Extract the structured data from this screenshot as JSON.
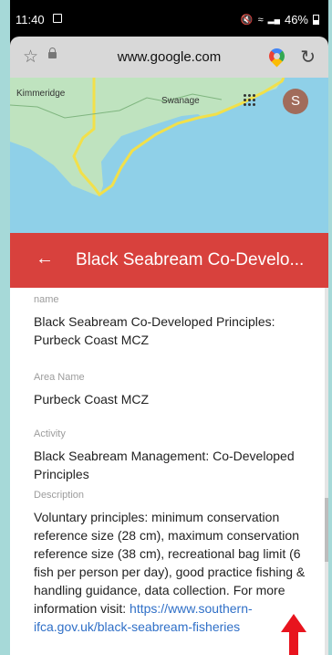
{
  "status_bar": {
    "time": "11:40",
    "battery": "46%"
  },
  "browser": {
    "url": "www.google.com"
  },
  "map": {
    "labels": [
      "Kimmeridge",
      "Swanage"
    ],
    "avatar_letter": "S"
  },
  "header": {
    "title": "Black Seabream Co-Develo..."
  },
  "fields": [
    {
      "label": "name",
      "value": "Black Seabream Co-Developed Principles: Purbeck Coast MCZ"
    },
    {
      "label": "Area Name",
      "value": "Purbeck Coast MCZ"
    },
    {
      "label": "Activity",
      "value": "Black Seabream Management: Co-Developed Principles"
    },
    {
      "label": "Description",
      "value": "Voluntary principles: minimum conservation reference size (28 cm), maximum conservation reference size (38 cm), recreational bag limit (6 fish per person per day), good practice fishing & handling guidance, data collection. For more information visit: ",
      "link": "https://www.southern-ifca.gov.uk/black-seabream-fisheries"
    }
  ],
  "colors": {
    "header": "#d8413d",
    "link": "#2f6fc7",
    "sea": "#8fd0e8",
    "land": "#bfe3bf",
    "boundary": "#f2e04a"
  }
}
